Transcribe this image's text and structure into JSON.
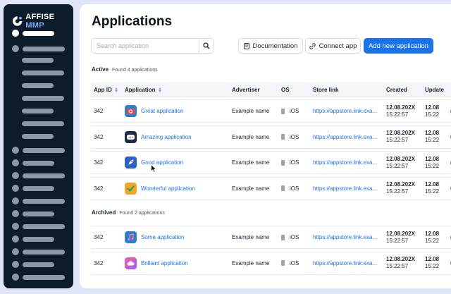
{
  "brand": {
    "name": "AFFISE",
    "suffix": "MMP"
  },
  "page": {
    "title": "Applications"
  },
  "search": {
    "placeholder": "Search application"
  },
  "toolbar": {
    "documentation": "Documentation",
    "connect_app": "Connect app",
    "add_new": "Add new application"
  },
  "columns": [
    "App ID",
    "Application",
    "Advertiser",
    "OS",
    "Store link",
    "Created",
    "Update"
  ],
  "active": {
    "label": "Active",
    "count_text": "Found 4 applications",
    "rows": [
      {
        "id": "342",
        "name": "Great application",
        "advertiser": "Example name",
        "os": "iOS",
        "store_link": "https://appstore.link.exa...",
        "created_date": "12.08.202X",
        "created_time": "15:22:57",
        "updated_date": "12.08",
        "updated_time": "15:22",
        "icon": "camera-icon"
      },
      {
        "id": "342",
        "name": "Amazing application",
        "advertiser": "Example name",
        "os": "iOS",
        "store_link": "https://appstore.link.exa...",
        "created_date": "12.08.202X",
        "created_time": "15:22:57",
        "updated_date": "12.08",
        "updated_time": "15:22",
        "icon": "chat-icon"
      },
      {
        "id": "342",
        "name": "Good application",
        "advertiser": "Example name",
        "os": "iOS",
        "store_link": "https://appstore.link.exa...",
        "created_date": "12.08.202X",
        "created_time": "15:22:57",
        "updated_date": "12.08",
        "updated_time": "15:22",
        "icon": "rocket-icon"
      },
      {
        "id": "342",
        "name": "Wonderful application",
        "advertiser": "Example name",
        "os": "iOS",
        "store_link": "https://appstore.link.exa...",
        "created_date": "12.08.202X",
        "created_time": "15:22:57",
        "updated_date": "12.08",
        "updated_time": "15:22",
        "icon": "checkmark-icon"
      }
    ]
  },
  "archived": {
    "label": "Archived",
    "count_text": "Found 2 applications",
    "rows": [
      {
        "id": "342",
        "name": "Some application",
        "advertiser": "Example name",
        "os": "iOS",
        "store_link": "https://appstore.link.exa...",
        "created_date": "12.08.202X",
        "created_time": "15:22:57",
        "updated_date": "12.08",
        "updated_time": "15:22",
        "icon": "music-icon"
      },
      {
        "id": "342",
        "name": "Brilliant application",
        "advertiser": "Example name",
        "os": "iOS",
        "store_link": "https://appstore.link.exa...",
        "created_date": "12.08.202X",
        "created_time": "15:22:57",
        "updated_date": "12.08",
        "updated_time": "15:22",
        "icon": "cloud-icon"
      }
    ]
  },
  "colors": {
    "accent": "#1a73e8",
    "sidebar": "#0d1b2a",
    "status": "#e5484d"
  }
}
